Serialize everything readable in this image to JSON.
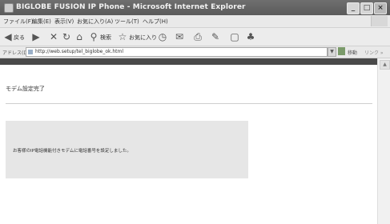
{
  "window": {
    "title": "BIGLOBE FUSION IP Phone - Microsoft Internet Explorer",
    "minimize_glyph": "_",
    "maximize_glyph": "□",
    "close_glyph": "×"
  },
  "menubar": {
    "items": [
      "ファイル(F)",
      "編集(E)",
      "表示(V)",
      "お気に入り(A)",
      "ツール(T)",
      "ヘルプ(H)"
    ]
  },
  "toolbar": {
    "back_label": "戻る",
    "search_label": "検索",
    "favorites_label": "お気に入り",
    "icons": [
      "back-icon",
      "forward-icon",
      "stop-icon",
      "refresh-icon",
      "home-icon",
      "search-icon",
      "favorites-icon",
      "history-icon",
      "mail-icon",
      "print-icon",
      "edit-icon",
      "discuss-icon",
      "messenger-icon"
    ]
  },
  "addressbar": {
    "label": "アドレス(D)",
    "url": "http://web.setup/tel_biglobe_ok.html",
    "go_label": "移動",
    "links_label": "リンク »"
  },
  "page": {
    "heading": "モデム設定完了",
    "message": "お客様のIP電話機能付きモデムに電話番号を設定しました。"
  },
  "colors": {
    "titlebar": "#5f5f5f",
    "chrome": "#e9e9e9",
    "dark_strip": "#4a4a4a",
    "message_box": "#e6e6e6"
  }
}
